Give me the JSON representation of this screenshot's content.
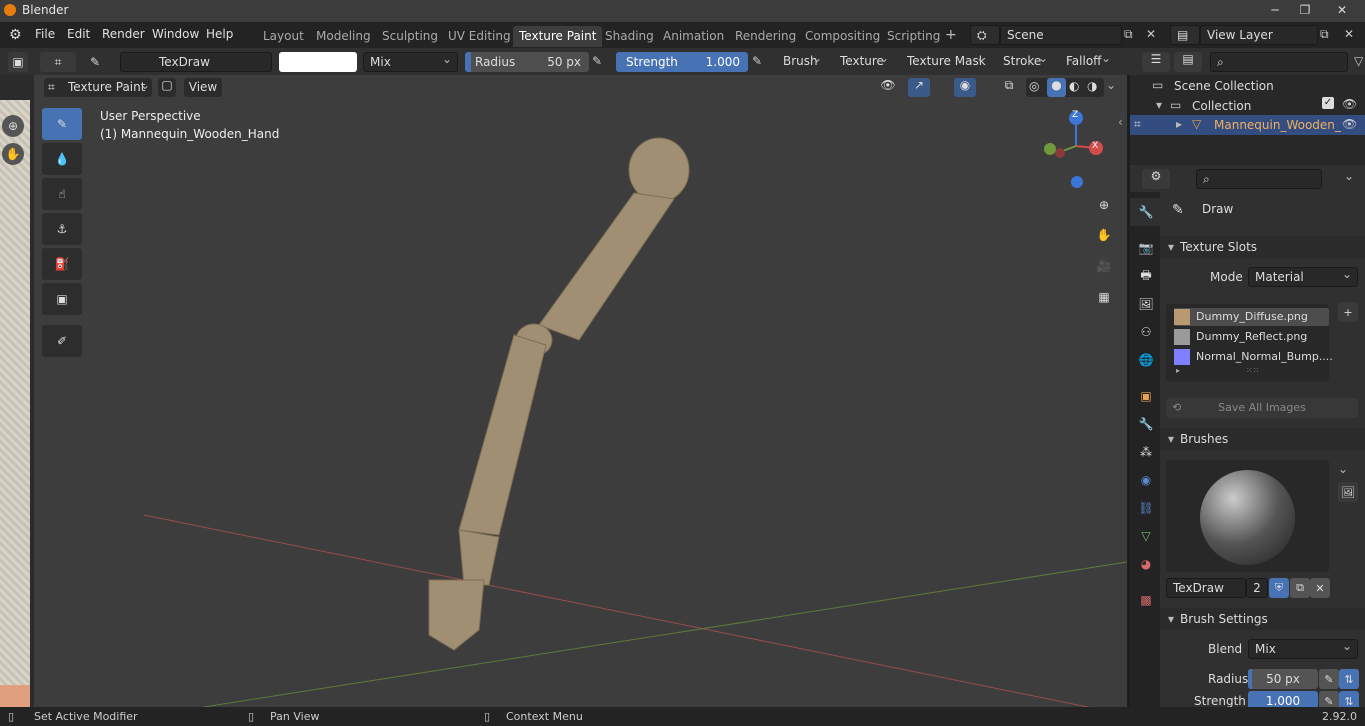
{
  "app": {
    "title": "Blender",
    "version": "2.92.0"
  },
  "menu": [
    "File",
    "Edit",
    "Render",
    "Window",
    "Help"
  ],
  "workspaces": [
    "Layout",
    "Modeling",
    "Sculpting",
    "UV Editing",
    "Texture Paint",
    "Shading",
    "Animation",
    "Rendering",
    "Compositing",
    "Scripting"
  ],
  "active_workspace": "Texture Paint",
  "scene": {
    "name": "Scene",
    "view_layer": "View Layer"
  },
  "tool_header": {
    "brush_name": "TexDraw",
    "blend": "Mix",
    "radius_label": "Radius",
    "radius_value": "50 px",
    "strength_label": "Strength",
    "strength_value": "1.000",
    "menus": [
      "Brush",
      "Texture",
      "Texture Mask",
      "Stroke",
      "Falloff"
    ]
  },
  "viewport_header": {
    "mode": "Texture Paint",
    "view": "View"
  },
  "viewport": {
    "perspective": "User Perspective",
    "object_label": "(1) Mannequin_Wooden_Hand",
    "gizmo_axes": {
      "x": "X",
      "y": "Y",
      "z": "Z"
    },
    "colors": {
      "bg": "#3d3d3d",
      "wood": "#a08f72",
      "x_axis": "#d44c4c",
      "y_axis": "#6f9a3c",
      "z_axis": "#3c76d6"
    }
  },
  "outliner": {
    "scene_collection": "Scene Collection",
    "collection": "Collection",
    "object": "Mannequin_Wooden_"
  },
  "properties": {
    "active_tool": "Draw",
    "texture_slots": {
      "title": "Texture Slots",
      "mode_label": "Mode",
      "mode_value": "Material",
      "slots": [
        {
          "name": "Dummy_Diffuse.png",
          "color": "#b89a72"
        },
        {
          "name": "Dummy_Reflect.png",
          "color": "#9a9a9a"
        },
        {
          "name": "Normal_Normal_Bump....",
          "color": "#7f7fff"
        }
      ],
      "save_all": "Save All Images"
    },
    "brushes": {
      "title": "Brushes",
      "brush_name": "TexDraw",
      "users": "2"
    },
    "brush_settings": {
      "title": "Brush Settings",
      "blend_label": "Blend",
      "blend_value": "Mix",
      "radius_label": "Radius",
      "radius_value": "50 px",
      "strength_label": "Strength",
      "strength_value": "1.000"
    }
  },
  "status_bar": {
    "left": "Set Active Modifier",
    "middle": "Pan View",
    "right": "Context Menu"
  }
}
